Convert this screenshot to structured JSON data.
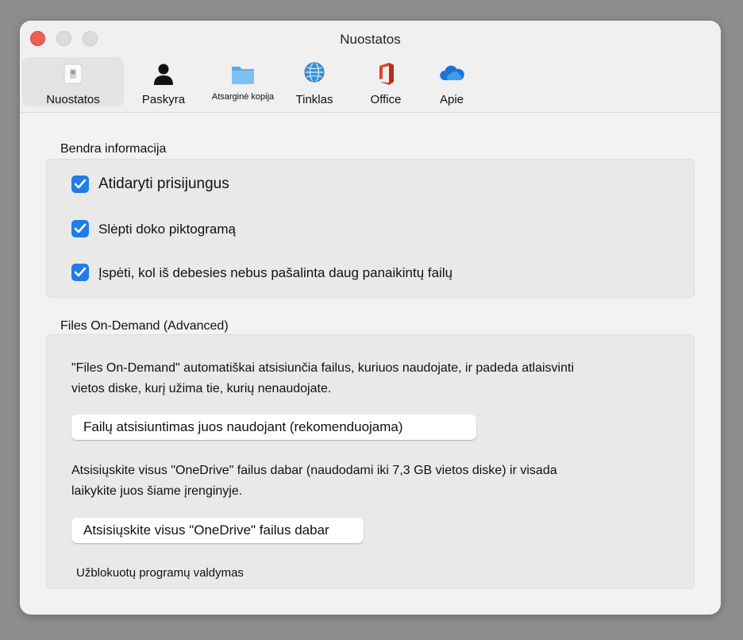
{
  "window": {
    "title": "Nuostatos"
  },
  "tabs": [
    {
      "label": "Nuostatos",
      "icon": "settings-switch-icon",
      "active": true
    },
    {
      "label": "Paskyra",
      "icon": "person-icon"
    },
    {
      "label": "Atsarginė kopija",
      "icon": "folder-icon"
    },
    {
      "label": "Tinklas",
      "icon": "globe-icon"
    },
    {
      "label": "Office",
      "icon": "office-icon"
    },
    {
      "label": "Apie",
      "icon": "cloud-icon"
    }
  ],
  "general": {
    "title": "Bendra informacija",
    "options": [
      {
        "label": "Atidaryti prisijungus",
        "checked": true
      },
      {
        "label": "Slėpti doko piktogramą",
        "checked": true
      },
      {
        "label": "Įspėti, kol iš debesies nebus pašalinta daug panaikintų failų",
        "checked": true
      }
    ]
  },
  "fod": {
    "title": "Files On-Demand (Advanced)",
    "description_line1": "\"Files On-Demand\" automatiškai atsisiunčia failus, kuriuos naudojate, ir padeda atlaisvinti",
    "description_line2": "vietos diske, kurį užima tie, kurių nenaudojate.",
    "button_on_demand": "Failų atsisiuntimas juos naudojant (rekomenduojama)",
    "download_all_line1": "Atsisiųskite visus \"OneDrive\" failus dabar (naudodami iki 7,3 GB vietos diske) ir visada",
    "download_all_line2": "laikykite juos šiame įrenginyje.",
    "button_download_all": "Atsisiųskite visus \"OneDrive\" failus dabar",
    "blocked_apps": "Užblokuotų programų valdymas"
  },
  "colors": {
    "accent": "#1f7ee6",
    "close": "#ee5e57"
  }
}
